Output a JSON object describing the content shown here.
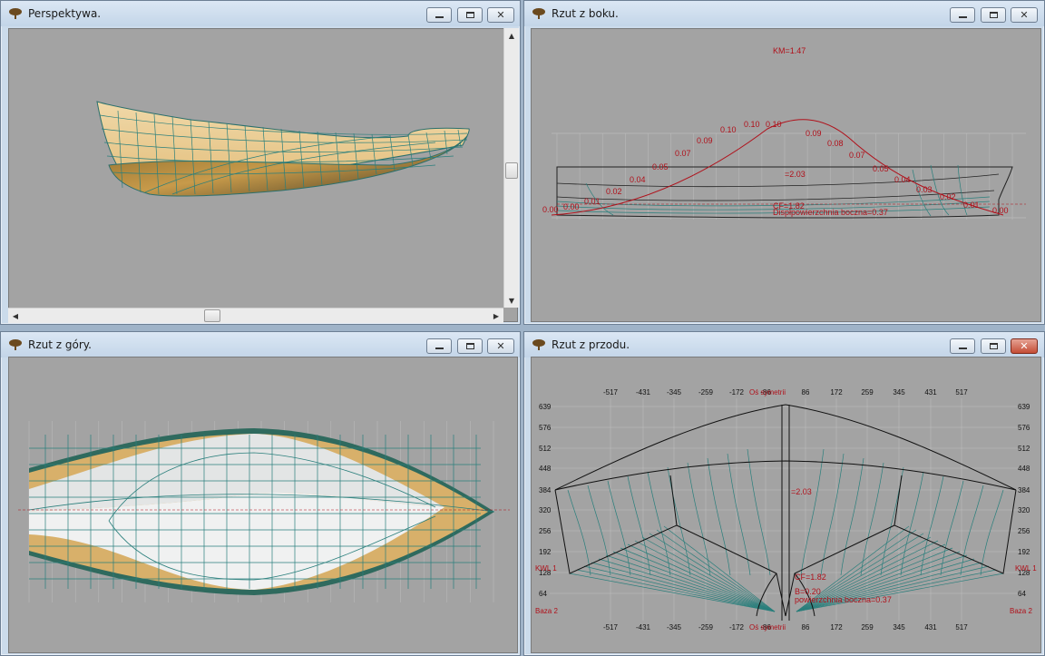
{
  "windows": {
    "perspective": {
      "title": "Perspektywa."
    },
    "side": {
      "title": "Rzut z boku."
    },
    "top": {
      "title": "Rzut z góry."
    },
    "front": {
      "title": "Rzut z przodu."
    }
  },
  "title_buttons": {
    "minimize": "minimize-icon",
    "maximize": "maximize-icon",
    "close": "✕"
  },
  "colors": {
    "hull_tan": "#e9c889",
    "grid_teal": "#2a7f7c",
    "label_red": "#b0101a",
    "bg_gray": "#a3a3a3"
  },
  "side_view": {
    "km_label": "KM=1.47",
    "z_label": "=2.03",
    "cf_label": "CF=1.82",
    "lateral_label": "Dispłpowierzchnia boczna=0.37",
    "curve_values": [
      "0.00",
      "0.00",
      "0.01",
      "0.02",
      "0.04",
      "0.05",
      "0.07",
      "0.09",
      "0.10",
      "0.10",
      "0.10",
      "0.09",
      "0.08",
      "0.07",
      "0.05",
      "0.04",
      "0.03",
      "0.02",
      "0.01",
      "0.00"
    ]
  },
  "front_view": {
    "axis_label_top": "Oś symetrii",
    "axis_label_bottom": "Oś symetrii",
    "x_ticks": [
      "-517",
      "-431",
      "-345",
      "-259",
      "-172",
      "-86",
      "86",
      "172",
      "259",
      "345",
      "431",
      "517"
    ],
    "y_ticks": [
      "639",
      "576",
      "512",
      "448",
      "384",
      "320",
      "256",
      "192",
      "128",
      "64"
    ],
    "waterline_left": "KWL 1",
    "waterline_right": "KWL 1",
    "base_left": "Baza 2",
    "base_right": "Baza 2",
    "z_label": "=2.03",
    "cf_label": "CF=1.82",
    "b_label": "B=0.20",
    "lateral_label": "powierzchnia boczna=0.37"
  }
}
